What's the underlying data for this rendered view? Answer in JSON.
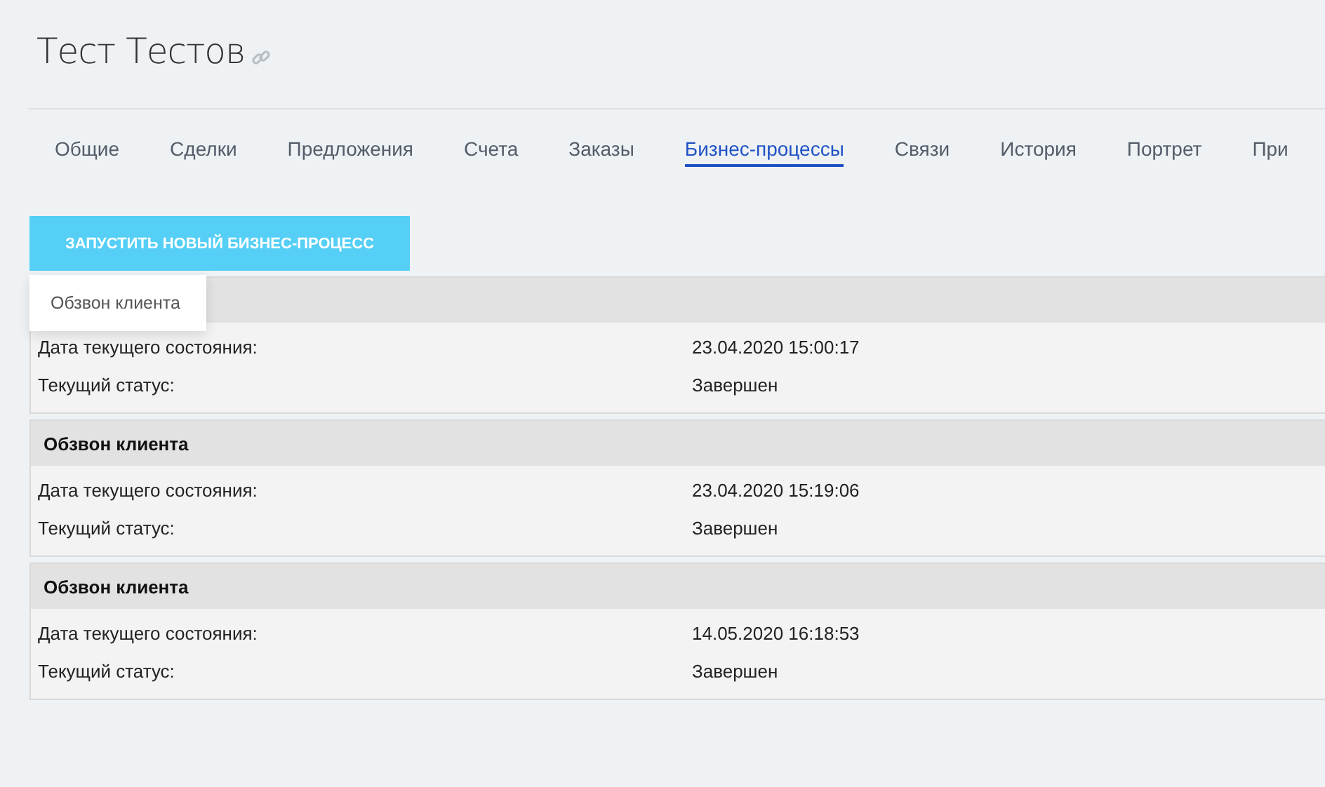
{
  "header": {
    "title": "Тест Тестов"
  },
  "tabs": [
    {
      "label": "Общие",
      "selected": false
    },
    {
      "label": "Сделки",
      "selected": false
    },
    {
      "label": "Предложения",
      "selected": false
    },
    {
      "label": "Счета",
      "selected": false
    },
    {
      "label": "Заказы",
      "selected": false
    },
    {
      "label": "Бизнес-процессы",
      "selected": true
    },
    {
      "label": "Связи",
      "selected": false
    },
    {
      "label": "История",
      "selected": false
    },
    {
      "label": "Портрет",
      "selected": false
    },
    {
      "label": "При",
      "selected": false
    }
  ],
  "start_button": {
    "label": "ЗАПУСТИТЬ НОВЫЙ БИЗНЕС-ПРОЦЕСС"
  },
  "dropdown_menu": {
    "items": [
      "Обзвон клиента"
    ]
  },
  "processes": [
    {
      "fields": [
        {
          "label": "Дата текущего состояния:",
          "value": "23.04.2020 15:00:17"
        },
        {
          "label": "Текущий статус:",
          "value": "Завершен"
        }
      ]
    },
    {
      "title": "Обзвон клиента",
      "fields": [
        {
          "label": "Дата текущего состояния:",
          "value": "23.04.2020 15:19:06"
        },
        {
          "label": "Текущий статус:",
          "value": "Завершен"
        }
      ]
    },
    {
      "title": "Обзвон клиента",
      "fields": [
        {
          "label": "Дата текущего состояния:",
          "value": "14.05.2020 16:18:53"
        },
        {
          "label": "Текущий статус:",
          "value": "Завершен"
        }
      ]
    }
  ]
}
